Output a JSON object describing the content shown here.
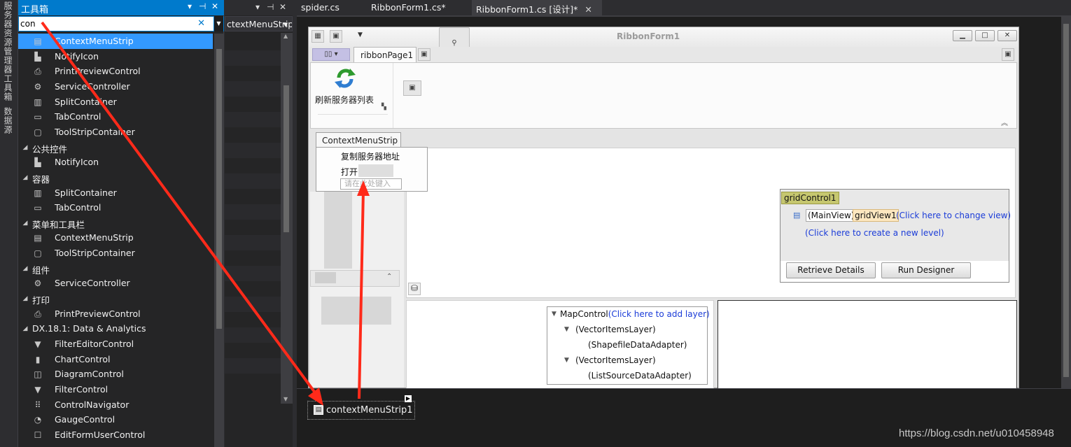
{
  "left_strip": {
    "tab1": "服务器资源管理器",
    "tab2": "工具箱",
    "tab3": "数据源"
  },
  "toolbox": {
    "title": "工具箱",
    "search_value": "con",
    "items": [
      {
        "label": "ContextMenuStrip",
        "icon": "context-menu-icon",
        "group": false,
        "selected": true
      },
      {
        "label": "NotifyIcon",
        "icon": "notify-icon",
        "group": false
      },
      {
        "label": "PrintPreviewControl",
        "icon": "print-preview-icon",
        "group": false
      },
      {
        "label": "ServiceController",
        "icon": "gear-icon",
        "group": false
      },
      {
        "label": "SplitContainer",
        "icon": "split-container-icon",
        "group": false
      },
      {
        "label": "TabControl",
        "icon": "tab-control-icon",
        "group": false
      },
      {
        "label": "ToolStripContainer",
        "icon": "toolstrip-container-icon",
        "group": false
      },
      {
        "label": "公共控件",
        "icon": "expand-arrow-icon",
        "group": true
      },
      {
        "label": "NotifyIcon",
        "icon": "notify-icon",
        "group": false
      },
      {
        "label": "容器",
        "icon": "expand-arrow-icon",
        "group": true
      },
      {
        "label": "SplitContainer",
        "icon": "split-container-icon",
        "group": false
      },
      {
        "label": "TabControl",
        "icon": "tab-control-icon",
        "group": false
      },
      {
        "label": "菜单和工具栏",
        "icon": "expand-arrow-icon",
        "group": true
      },
      {
        "label": "ContextMenuStrip",
        "icon": "context-menu-icon",
        "group": false
      },
      {
        "label": "ToolStripContainer",
        "icon": "toolstrip-container-icon",
        "group": false
      },
      {
        "label": "组件",
        "icon": "expand-arrow-icon",
        "group": true
      },
      {
        "label": "ServiceController",
        "icon": "gear-icon",
        "group": false
      },
      {
        "label": "打印",
        "icon": "expand-arrow-icon",
        "group": true
      },
      {
        "label": "PrintPreviewControl",
        "icon": "print-preview-icon",
        "group": false
      },
      {
        "label": "DX.18.1: Data & Analytics",
        "icon": "expand-arrow-icon",
        "group": true
      },
      {
        "label": "FilterEditorControl",
        "icon": "filter-editor-icon",
        "group": false
      },
      {
        "label": "ChartControl",
        "icon": "chart-icon",
        "group": false
      },
      {
        "label": "DiagramControl",
        "icon": "diagram-icon",
        "group": false
      },
      {
        "label": "FilterControl",
        "icon": "filter-icon",
        "group": false
      },
      {
        "label": "ControlNavigator",
        "icon": "navigator-icon",
        "group": false
      },
      {
        "label": "GaugeControl",
        "icon": "gauge-icon",
        "group": false
      },
      {
        "label": "EditFormUserControl",
        "icon": "edit-form-icon",
        "group": false
      }
    ]
  },
  "mid_panel": {
    "selector_value": "ctextMenuStrip"
  },
  "editor_tabs": [
    {
      "label": "spider.cs",
      "active": false
    },
    {
      "label": "RibbonForm1.cs*",
      "active": false
    },
    {
      "label": "RibbonForm1.cs [设计]*",
      "active": true
    }
  ],
  "form": {
    "title": "RibbonForm1",
    "page_tab": "ribbonPage1",
    "ribbon_button": "刷新服务器列表",
    "context_menu": {
      "caption": "ContextMenuStrip",
      "item1": "复制服务器地址",
      "item2": "打开",
      "placeholder": "请在此处键入"
    },
    "grid": {
      "name": "gridControl1",
      "main_view": "(MainView)",
      "grid_view": "gridView1",
      "change_view": "(Click here to change view)",
      "new_level": "(Click here to create a new level)",
      "btn_retrieve": "Retrieve Details",
      "btn_designer": "Run Designer"
    },
    "map": {
      "root": "MapControl",
      "root_link": "(Click here to add layer)",
      "layer1": "(VectorItemsLayer)",
      "adapter1": "(ShapefileDataAdapter)",
      "layer2": "(VectorItemsLayer)",
      "adapter2": "(ListSourceDataAdapter)"
    }
  },
  "tray": {
    "component": "contextMenuStrip1"
  },
  "watermark": "https://blog.csdn.net/u010458948",
  "colors": {
    "accent": "#007acc",
    "selection": "#3399ff",
    "arrow": "#ff2a1a",
    "link": "#1b3cd8",
    "grid_name": "#c6c76f"
  }
}
